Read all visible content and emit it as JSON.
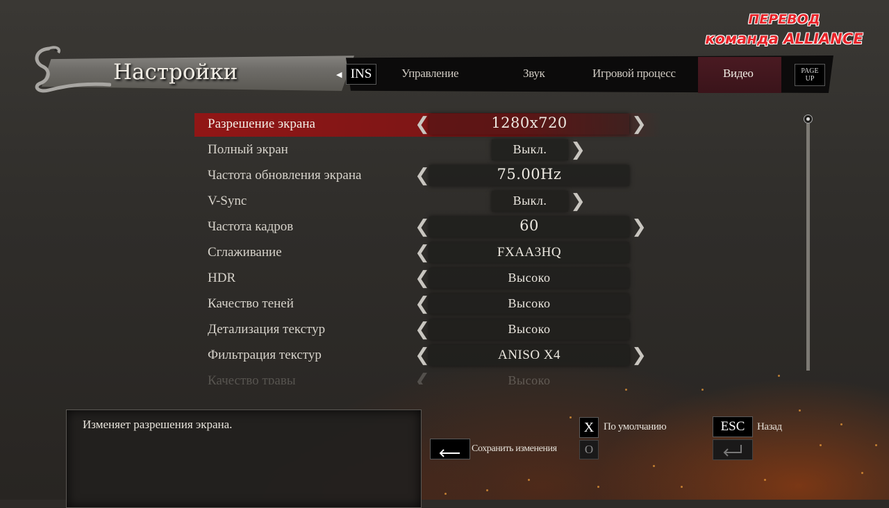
{
  "watermark": {
    "line1": "ПЕРЕВОД",
    "line2": "команда ALLIANCE"
  },
  "header": {
    "title": "Настройки",
    "prev_key": "INS",
    "next_key_line1": "PAGE",
    "next_key_line2": "UP",
    "tabs": [
      {
        "label": "Управление",
        "active": false
      },
      {
        "label": "Звук",
        "active": false
      },
      {
        "label": "Игровой процесс",
        "active": false
      },
      {
        "label": "Видео",
        "active": true
      }
    ]
  },
  "settings": [
    {
      "label": "Разрешение экрана",
      "value": "1280x720",
      "selected": true
    },
    {
      "label": "Полный экран",
      "value": "Выкл."
    },
    {
      "label": "Частота обновления экрана",
      "value": "75.00Hz"
    },
    {
      "label": "V-Sync",
      "value": "Выкл."
    },
    {
      "label": "Частота кадров",
      "value": "60"
    },
    {
      "label": "Сглаживание",
      "value": "FXAA3HQ"
    },
    {
      "label": "HDR",
      "value": "Высоко"
    },
    {
      "label": "Качество теней",
      "value": "Высоко"
    },
    {
      "label": "Детализация текстур",
      "value": "Высоко"
    },
    {
      "label": "Фильтрация текстур",
      "value": "ANISO X4"
    },
    {
      "label": "Качество травы",
      "value": "Высоко"
    }
  ],
  "description": "Изменяет разрешения экрана.",
  "hints": {
    "default_key": "X",
    "default_label": "По умолчанию",
    "back_key": "ESC",
    "back_label": "Назад",
    "save_label": "Сохранить изменения",
    "alt_key": "O"
  },
  "colors": {
    "highlight": "#8e1616",
    "video_tab": "#4a1a22",
    "watermark": "#e8242a"
  }
}
